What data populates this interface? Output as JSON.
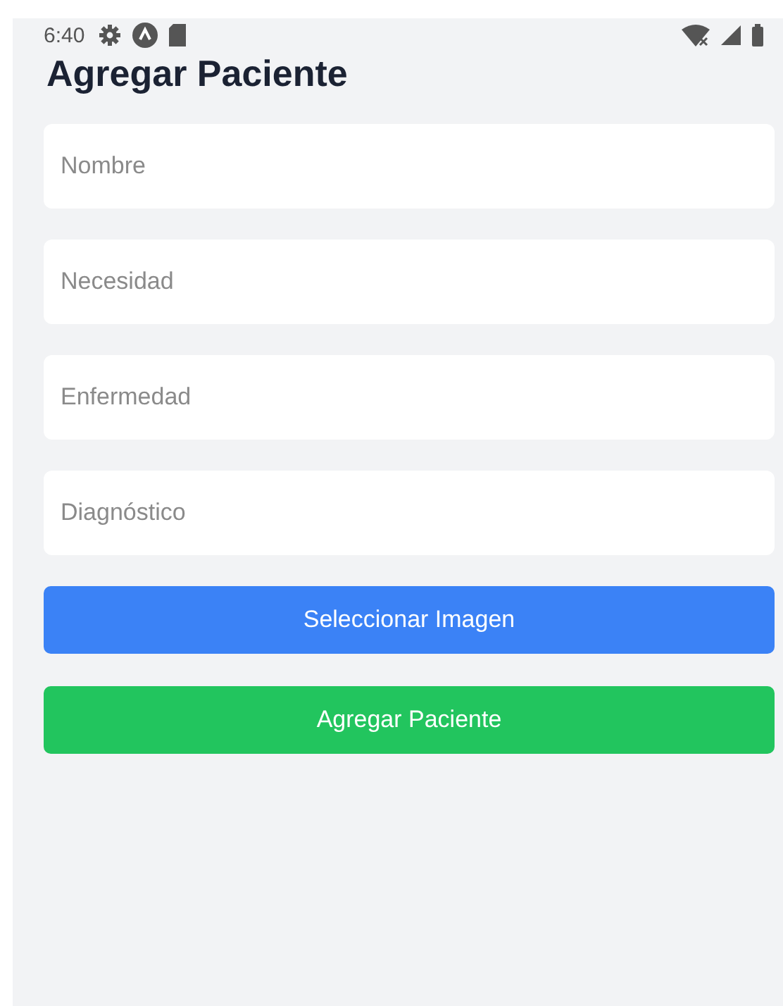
{
  "status_bar": {
    "time": "6:40"
  },
  "title": "Agregar Paciente",
  "fields": [
    {
      "placeholder": "Nombre"
    },
    {
      "placeholder": "Necesidad"
    },
    {
      "placeholder": "Enfermedad"
    },
    {
      "placeholder": "Diagnóstico"
    }
  ],
  "buttons": [
    {
      "label": "Seleccionar Imagen",
      "kind": "primary"
    },
    {
      "label": "Agregar Paciente",
      "kind": "success"
    }
  ]
}
